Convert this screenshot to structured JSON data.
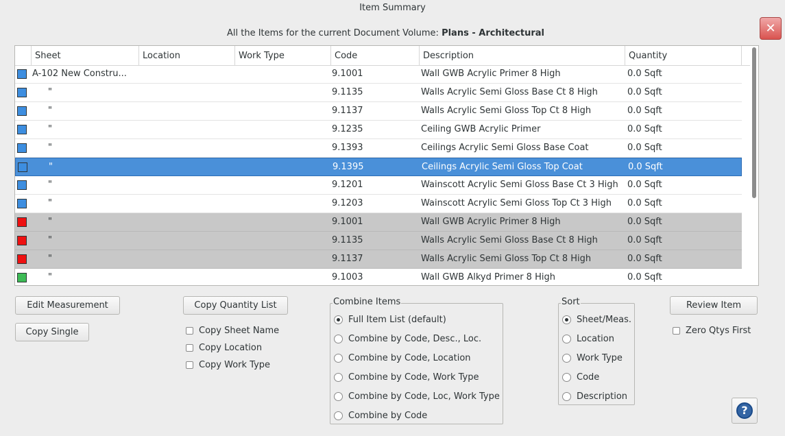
{
  "window": {
    "title": "Item Summary"
  },
  "subtitle": {
    "prefix": "All the Items for the current Document Volume:",
    "volume": "Plans - Architectural"
  },
  "table": {
    "columns": [
      "Sheet",
      "Location",
      "Work Type",
      "Code",
      "Description",
      "Quantity"
    ],
    "rows": [
      {
        "color": "#3d8ee0",
        "sheet": "A-102 New Constru...",
        "location": "",
        "worktype": "",
        "code": "9.1001",
        "description": "Wall GWB Acrylic Primer 8 High",
        "quantity": "0.0 Sqft"
      },
      {
        "color": "#3d8ee0",
        "sheet": "\"",
        "location": "",
        "worktype": "",
        "code": "9.1135",
        "description": "Walls Acrylic Semi Gloss Base Ct 8 High",
        "quantity": "0.0 Sqft"
      },
      {
        "color": "#3d8ee0",
        "sheet": "\"",
        "location": "",
        "worktype": "",
        "code": "9.1137",
        "description": "Walls Acrylic Semi Gloss Top Ct 8 High",
        "quantity": "0.0 Sqft"
      },
      {
        "color": "#3d8ee0",
        "sheet": "\"",
        "location": "",
        "worktype": "",
        "code": "9.1235",
        "description": "Ceiling GWB  Acrylic Primer",
        "quantity": "0.0 Sqft"
      },
      {
        "color": "#3d8ee0",
        "sheet": "\"",
        "location": "",
        "worktype": "",
        "code": "9.1393",
        "description": "Ceilings Acrylic Semi Gloss Base Coat",
        "quantity": "0.0 Sqft"
      },
      {
        "color": "#3d8ee0",
        "sheet": "\"",
        "location": "",
        "worktype": "",
        "code": "9.1395",
        "description": "Ceilings Acrylic Semi Gloss Top Coat",
        "quantity": "0.0 Sqft"
      },
      {
        "color": "#3d8ee0",
        "sheet": "\"",
        "location": "",
        "worktype": "",
        "code": "9.1201",
        "description": "Wainscott Acrylic Semi Gloss Base Ct 3 High",
        "quantity": "0.0 Sqft"
      },
      {
        "color": "#3d8ee0",
        "sheet": "\"",
        "location": "",
        "worktype": "",
        "code": "9.1203",
        "description": "Wainscott Acrylic Semi Gloss Top Ct 3 High",
        "quantity": "0.0 Sqft"
      },
      {
        "color": "#ee1111",
        "sheet": "\"",
        "location": "",
        "worktype": "",
        "code": "9.1001",
        "description": "Wall GWB Acrylic Primer 8 High",
        "quantity": "0.0 Sqft"
      },
      {
        "color": "#ee1111",
        "sheet": "\"",
        "location": "",
        "worktype": "",
        "code": "9.1135",
        "description": "Walls Acrylic Semi Gloss Base Ct 8 High",
        "quantity": "0.0 Sqft"
      },
      {
        "color": "#ee1111",
        "sheet": "\"",
        "location": "",
        "worktype": "",
        "code": "9.1137",
        "description": "Walls Acrylic Semi Gloss Top Ct 8 High",
        "quantity": "0.0 Sqft"
      },
      {
        "color": "#3dbb55",
        "sheet": "\"",
        "location": "",
        "worktype": "",
        "code": "9.1003",
        "description": "Wall GWB Alkyd Primer 8 High",
        "quantity": "0.0 Sqft"
      }
    ]
  },
  "buttons": {
    "edit_measurement": "Edit Measurement",
    "copy_single": "Copy Single",
    "copy_quantity_list": "Copy Quantity List",
    "review_item": "Review Item"
  },
  "copy_options": [
    "Copy Sheet Name",
    "Copy Location",
    "Copy Work Type"
  ],
  "combine": {
    "title": "Combine Items",
    "options": [
      "Full Item List (default)",
      "Combine by Code, Desc., Loc.",
      "Combine by Code, Location",
      "Combine by Code, Work Type",
      "Combine by Code, Loc, Work Type",
      "Combine by Code"
    ]
  },
  "sort": {
    "title": "Sort",
    "options": [
      "Sheet/Meas.",
      "Location",
      "Work Type",
      "Code",
      "Description"
    ]
  },
  "zero_qtys_first": "Zero Qtys First",
  "icons": {
    "close": "close-icon",
    "help": "help-icon"
  }
}
